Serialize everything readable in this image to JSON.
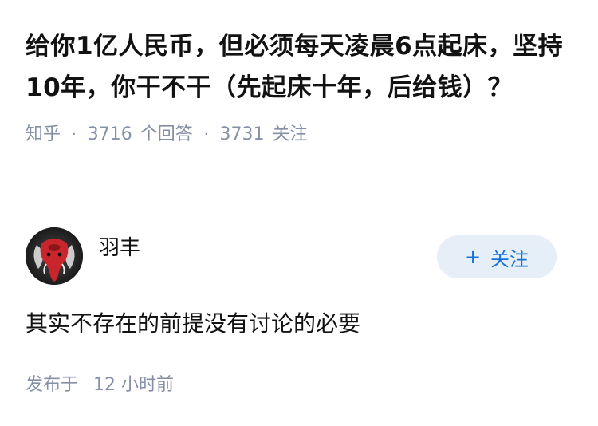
{
  "question": {
    "title": "给你1亿人民币，但必须每天凌晨6点起床，坚持10年，你干不干（先起床十年，后给钱）？",
    "source": "知乎",
    "answer_count": "3716",
    "answer_label": "个回答",
    "follower_count": "3731",
    "follower_label": "关注"
  },
  "answer": {
    "author": {
      "name": "羽丰",
      "avatar_icon": "elephant-avatar"
    },
    "follow_button": {
      "plus": "+",
      "label": "关注"
    },
    "content": "其实不存在的前提没有讨论的必要",
    "published_label": "发布于",
    "published_time": "12 小时前"
  },
  "colors": {
    "meta_gray": "#8590a6",
    "follow_bg": "#e6eef8",
    "follow_text": "#1772d5",
    "divider": "#ebebeb"
  }
}
